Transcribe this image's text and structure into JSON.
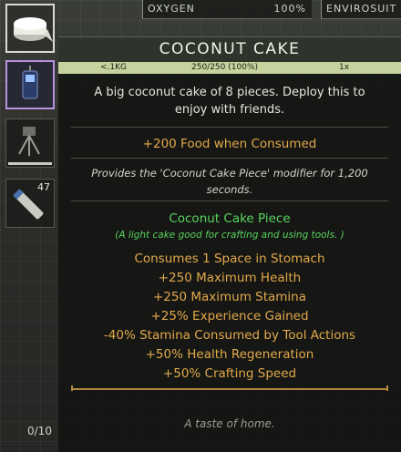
{
  "status": {
    "oxygen_label": "OXYGEN",
    "oxygen_value": "100%",
    "enviro_label": "ENVIROSUIT"
  },
  "slots": [
    {
      "name": "coconut-cake",
      "icon": "cake-icon",
      "selected": true
    },
    {
      "name": "scanner",
      "icon": "scanner-icon",
      "equipped": true
    },
    {
      "name": "tripod-tool",
      "icon": "tripod-icon"
    },
    {
      "name": "canister",
      "icon": "canister-icon",
      "quantity": "47"
    }
  ],
  "counter": "0/10",
  "tooltip": {
    "title": "COCONUT CAKE",
    "weight": "<.1KG",
    "durability": "250/250 (100%)",
    "stack": "1x",
    "description": "A big coconut cake of 8 pieces. Deploy this to enjoy with friends.",
    "effect": "+200 Food when Consumed",
    "modifier_note": "Provides the 'Coconut Cake Piece' modifier for 1,200 seconds.",
    "modifier_name": "Coconut Cake Piece",
    "modifier_desc": "(A light cake good for crafting and using tools. )",
    "stats": [
      "Consumes 1 Space in Stomach",
      "+250 Maximum Health",
      "+250 Maximum Stamina",
      "+25% Experience Gained",
      "-40% Stamina Consumed by Tool Actions",
      "+50% Health Regeneration",
      "+50% Crafting Speed"
    ],
    "flavor": "A taste of home."
  },
  "colors": {
    "accent_orange": "#e2a94b",
    "accent_green": "#57d35e",
    "header_bar": "#c7d39e",
    "equipped_border": "#b892e0"
  }
}
